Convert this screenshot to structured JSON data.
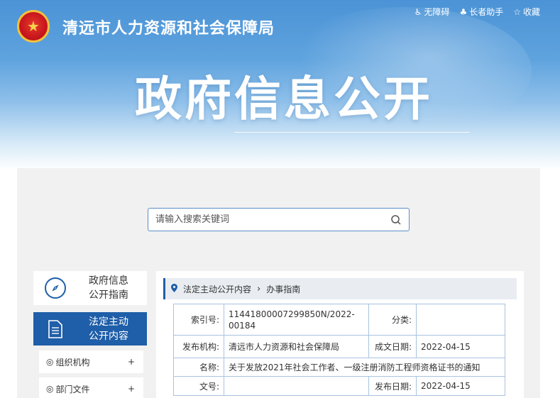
{
  "header": {
    "site_title": "清远市人力资源和社会保障局",
    "hero_title": "政府信息公开",
    "links": [
      {
        "label": "无障碍",
        "icon": "accessibility-icon"
      },
      {
        "label": "长者助手",
        "icon": "elder-helper-icon"
      },
      {
        "label": "收藏",
        "icon": "star-icon"
      }
    ]
  },
  "search": {
    "placeholder": "请输入搜索关键词"
  },
  "sidebar": {
    "cards": [
      {
        "label_line1": "政府信息",
        "label_line2": "公开指南"
      },
      {
        "label_line1": "法定主动",
        "label_line2": "公开内容"
      }
    ],
    "items": [
      {
        "label": "组织机构",
        "toggle": "+"
      },
      {
        "label": "部门文件",
        "toggle": "+"
      }
    ]
  },
  "breadcrumb": {
    "parent": "法定主动公开内容",
    "current": "办事指南"
  },
  "info_table": {
    "index_label": "索引号:",
    "index_value": "11441800007299850N/2022-00184",
    "category_label": "分类:",
    "category_value": "",
    "publisher_label": "发布机构:",
    "publisher_value": "清远市人力资源和社会保障局",
    "created_label": "成文日期:",
    "created_value": "2022-04-15",
    "name_label": "名称:",
    "name_value": "关于发放2021年社会工作者、一级注册消防工程师资格证书的通知",
    "docno_label": "文号:",
    "docno_value": "",
    "published_label": "发布日期:",
    "published_value": "2022-04-15"
  },
  "colors": {
    "primary": "#1f5ea8",
    "banner_top": "#4b93d6",
    "table_border": "#a9c3e0"
  }
}
